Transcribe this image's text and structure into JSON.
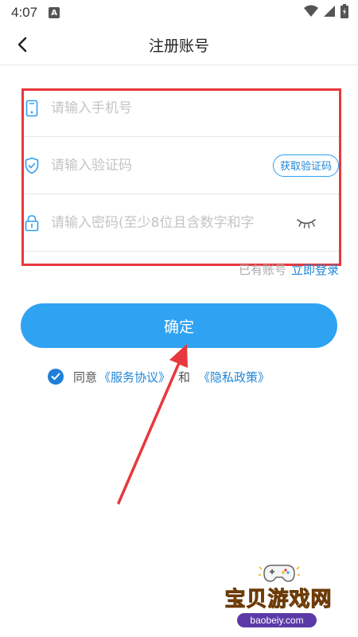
{
  "status_bar": {
    "time": "4:07",
    "notification_glyph": "A",
    "icons": [
      "wifi-icon",
      "signal-icon",
      "battery-icon"
    ]
  },
  "nav": {
    "title": "注册账号",
    "back_icon": "chevron-left-icon"
  },
  "form": {
    "phone_placeholder": "请输入手机号",
    "phone_value": "",
    "code_placeholder": "请输入验证码",
    "code_value": "",
    "get_code_label": "获取验证码",
    "password_placeholder": "请输入密码(至少8位且含数字和字",
    "password_value": "",
    "icons": [
      "phone-icon",
      "shield-check-icon",
      "lock-icon",
      "eye-closed-icon"
    ]
  },
  "login_prompt": {
    "question": "已有账号",
    "link": "立即登录"
  },
  "confirm_label": "确定",
  "agreement": {
    "checked": true,
    "prefix": "同意",
    "service_link": "《服务协议》",
    "and": "和",
    "privacy_link": "《隐私政策》"
  },
  "watermark": {
    "title": "宝贝游戏网",
    "url": "baobeiy.com"
  },
  "colors": {
    "accent": "#2fa3f2",
    "link": "#1f86d8",
    "highlight": "#e8383d",
    "placeholder": "#c4c4c4"
  }
}
